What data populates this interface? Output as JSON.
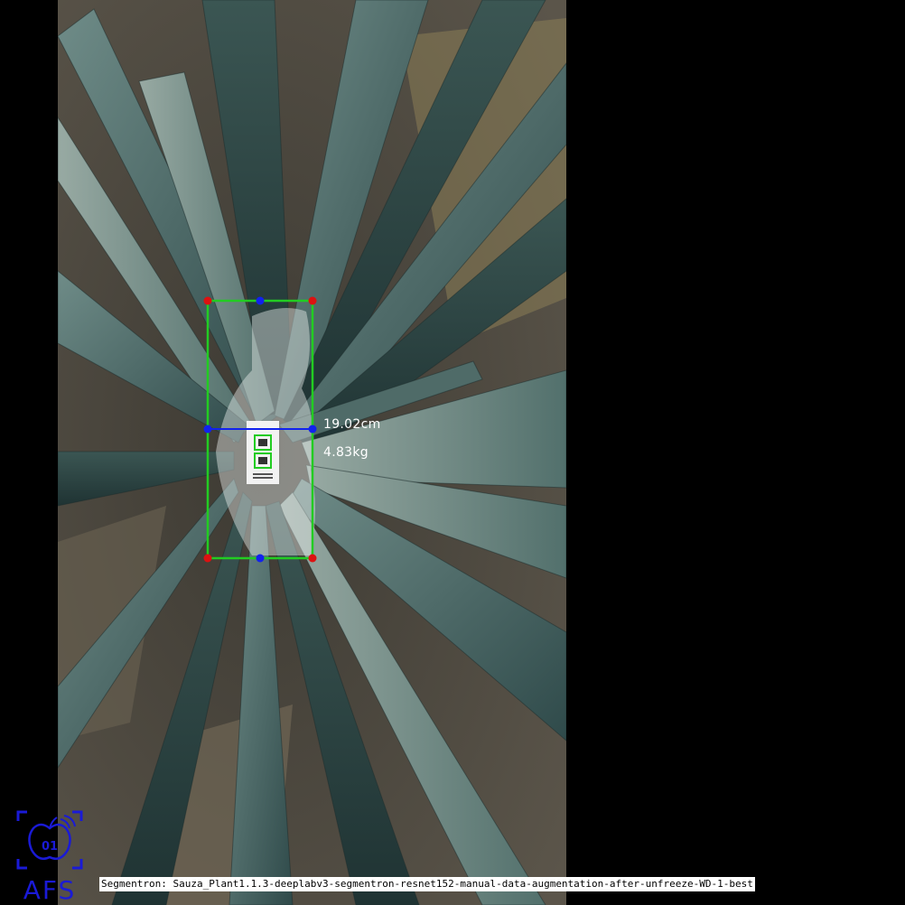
{
  "measurement": {
    "width": "19.02cm",
    "weight": "4.83kg"
  },
  "caption": "Segmentron: Sauza_Plant1.1.3-deeplabv3-segmentron-resnet152-manual-data-augmentation-after-unfreeze-WD-1-best",
  "logo": {
    "badge": "01",
    "text": "AFS"
  },
  "colors": {
    "bounding_box": "#22cc22",
    "corner_points": "#dd1111",
    "midpoints": "#1122ee",
    "logo": "#1a1ad6"
  }
}
